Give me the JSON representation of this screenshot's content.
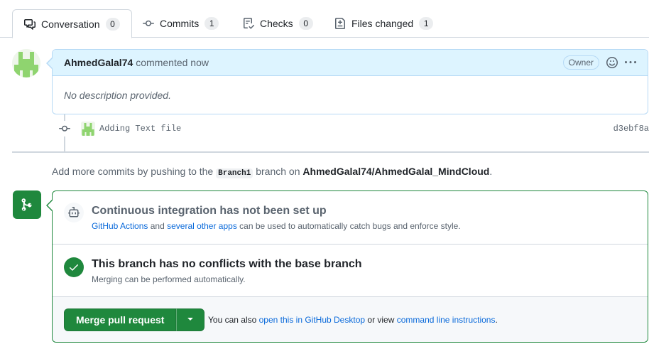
{
  "tabs": [
    {
      "label": "Conversation",
      "count": "0",
      "icon": "comment-discussion-icon"
    },
    {
      "label": "Commits",
      "count": "1",
      "icon": "git-commit-icon"
    },
    {
      "label": "Checks",
      "count": "0",
      "icon": "checklist-icon"
    },
    {
      "label": "Files changed",
      "count": "1",
      "icon": "file-diff-icon"
    }
  ],
  "comment": {
    "author": "AhmedGalal74",
    "meta": "commented now",
    "role_badge": "Owner",
    "body": "No description provided."
  },
  "commit": {
    "message": "Adding Text file",
    "sha": "d3ebf8a"
  },
  "push_hint": {
    "prefix": "Add more commits by pushing to the",
    "branch": "Branch1",
    "middle": "branch on",
    "repo": "AhmedGalal74/AhmedGalal_MindCloud",
    "suffix": "."
  },
  "ci": {
    "title": "Continuous integration has not been set up",
    "link1": "GitHub Actions",
    "and": "and",
    "link2": "several other apps",
    "rest": "can be used to automatically catch bugs and enforce style."
  },
  "conflicts": {
    "title": "This branch has no conflicts with the base branch",
    "subtitle": "Merging can be performed automatically."
  },
  "merge": {
    "button_label": "Merge pull request",
    "also_prefix": "You can also",
    "desktop_link": "open this in GitHub Desktop",
    "or_view": "or view",
    "cli_link": "command line instructions",
    "suffix": "."
  },
  "colors": {
    "green": "#1f883d",
    "blue_link": "#0969da",
    "comment_header": "#ddf4ff"
  }
}
